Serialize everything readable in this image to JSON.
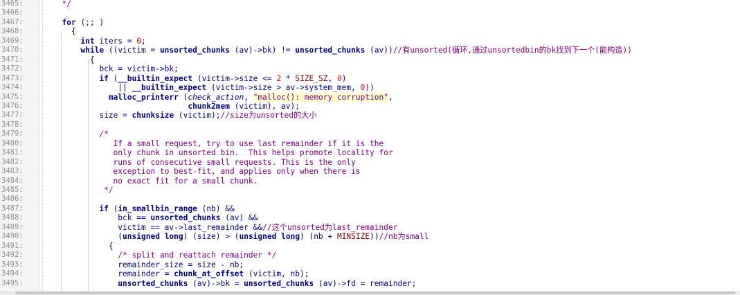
{
  "editor": {
    "lines": [
      {
        "n": "3465:",
        "code": "  */"
      },
      {
        "n": "3466:",
        "code": ""
      },
      {
        "n": "3467:",
        "code": "  for (;; )"
      },
      {
        "n": "3468:",
        "code": "    {"
      },
      {
        "n": "3469:",
        "code": "      int iters = 0;"
      },
      {
        "n": "3470:",
        "code": "      while ((victim = unsorted_chunks (av)->bk) != unsorted_chunks (av))//有unsorted(循环,通过unsortedbin的bk找到下一个(能构造))"
      },
      {
        "n": "3471:",
        "code": "        {"
      },
      {
        "n": "3472:",
        "code": "          bck = victim->bk;"
      },
      {
        "n": "3473:",
        "code": "          if (__builtin_expect (victim->size <= 2 * SIZE_SZ, 0)"
      },
      {
        "n": "3474:",
        "code": "              || __builtin_expect (victim->size > av->system_mem, 0))"
      },
      {
        "n": "3475:",
        "code": "            malloc_printerr (check_action, \"malloc(): memory corruption\","
      },
      {
        "n": "3476:",
        "code": "                             chunk2mem (victim), av);"
      },
      {
        "n": "3477:",
        "code": "          size = chunksize (victim);//size为unsorted的大小"
      },
      {
        "n": "3478:",
        "code": ""
      },
      {
        "n": "3479:",
        "code": "          /*"
      },
      {
        "n": "3480:",
        "code": "             If a small request, try to use last remainder if it is the"
      },
      {
        "n": "3481:",
        "code": "             only chunk in unsorted bin.  This helps promote locality for"
      },
      {
        "n": "3482:",
        "code": "             runs of consecutive small requests. This is the only"
      },
      {
        "n": "3483:",
        "code": "             exception to best-fit, and applies only when there is"
      },
      {
        "n": "3484:",
        "code": "             no exact fit for a small chunk."
      },
      {
        "n": "3485:",
        "code": "           */"
      },
      {
        "n": "3486:",
        "code": ""
      },
      {
        "n": "3487:",
        "code": "          if (in_smallbin_range (nb) &&"
      },
      {
        "n": "3488:",
        "code": "              bck == unsorted_chunks (av) &&"
      },
      {
        "n": "3489:",
        "code": "              victim == av->last_remainder &&//这个unsorted为last_remainder"
      },
      {
        "n": "3490:",
        "code": "              (unsigned long) (size) > (unsigned long) (nb + MINSIZE))//nb为small"
      },
      {
        "n": "3491:",
        "code": "            {"
      },
      {
        "n": "3492:",
        "code": "              /* split and reattach remainder */"
      },
      {
        "n": "3493:",
        "code": "              remainder_size = size - nb;"
      },
      {
        "n": "3494:",
        "code": "              remainder = chunk_at_offset (victim, nb);"
      },
      {
        "n": "3495:",
        "code": "              unsorted_chunks (av)->bk = unsorted_chunks (av)->fd = remainder;"
      }
    ]
  },
  "colors": {
    "keyword": "#000080",
    "number": "#ff0000",
    "comment": "#800080",
    "string_bg": "#ffffcc",
    "line_number": "#8f8f8f"
  }
}
